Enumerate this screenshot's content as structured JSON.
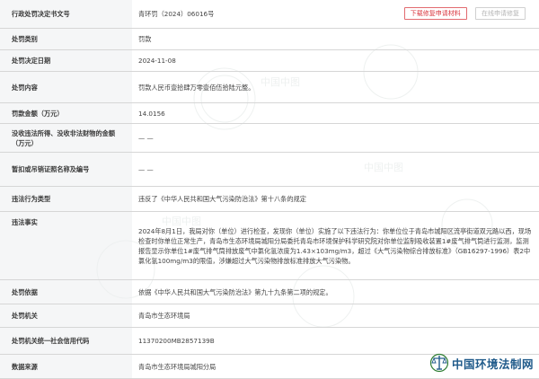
{
  "rows": {
    "doc_no": {
      "label": "行政处罚决定书文号",
      "value": "青环罚（2024）06016号"
    },
    "type": {
      "label": "处罚类别",
      "value": "罚款"
    },
    "date": {
      "label": "处罚决定日期",
      "value": "2024-11-08"
    },
    "content": {
      "label": "处罚内容",
      "value": "罚款人民币壹拾肆万零壹佰伍拾陆元整。"
    },
    "amount": {
      "label": "罚款金额（万元）",
      "value": "14.0156"
    },
    "confiscation": {
      "label": "没收违法所得、没收非法财物的金额（万元）",
      "value": "— —"
    },
    "license": {
      "label": "暂扣或吊销证照名称及编号",
      "value": "— —"
    },
    "violation": {
      "label": "违法行为类型",
      "value": "违反了《中华人民共和国大气污染防治法》第十八条的规定"
    },
    "facts": {
      "label": "违法事实",
      "value": "2024年8月1日，我局对你（单位）进行检查，发现你（单位）实施了以下违法行为：你单位位于青岛市城阳区流亭街道双元路以西，现场检查时你单位正常生产，青岛市生态环境局城阳分局委托青岛市环境保护科学研究院对你单位监制吸收装置1#废气排气筒进行监测，监测报告显示你单位1#废气排气筒排放废气中氯化氢浓度为1.43×103mg/m3，超过《大气污染物综合排放标准》（GB16297-1996）表2中氯化氢100mg/m3的限值，涉嫌超过大气污染物排放标准排放大气污染物。"
    },
    "basis": {
      "label": "处罚依据",
      "value": "依据《中华人民共和国大气污染防治法》第九十九条第二项的规定。"
    },
    "authority": {
      "label": "处罚机关",
      "value": "青岛市生态环境局"
    },
    "credit_code": {
      "label": "处罚机关统一社会信用代码",
      "value": "11370200MB2857139B"
    },
    "source": {
      "label": "数据来源",
      "value": "青岛市生态环境局城阳分局"
    }
  },
  "buttons": {
    "download": "下载修复申请材料",
    "online": "在线申请修复"
  },
  "watermark": {
    "text": "中国中图"
  },
  "logo": {
    "text": "中国环境法制网"
  },
  "colors": {
    "accent_red": "#d9363e",
    "logo_blue": "#1f5a8a",
    "logo_green": "#2e7d32"
  }
}
